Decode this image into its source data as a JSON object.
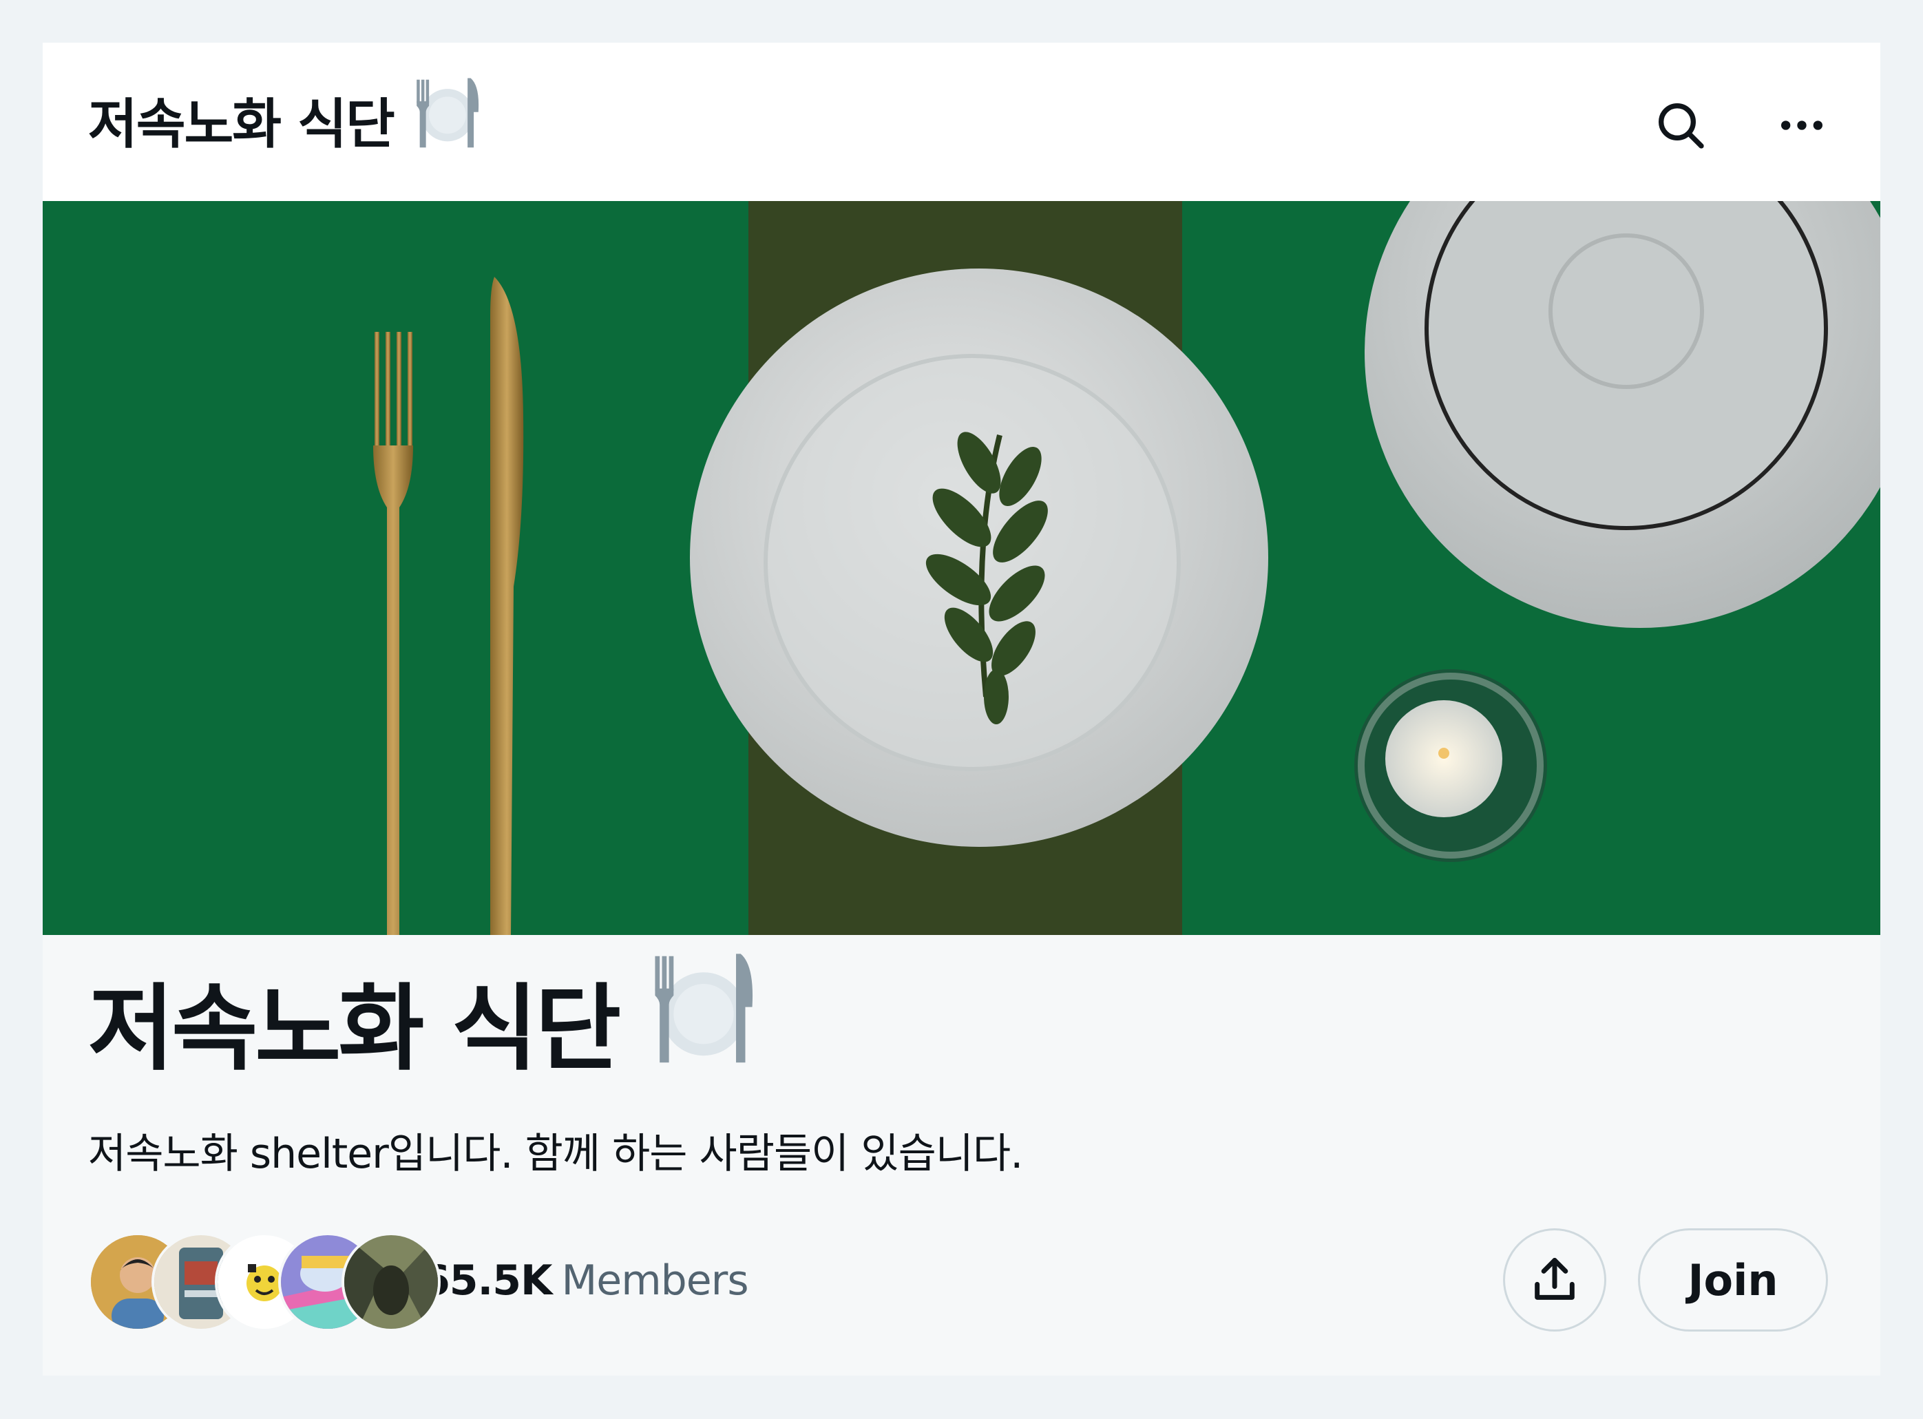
{
  "header": {
    "title": "저속노화 식단",
    "title_icon": "fork-knife-plate-icon",
    "actions": [
      {
        "name": "search",
        "icon": "search-icon"
      },
      {
        "name": "more",
        "icon": "more-icon"
      }
    ]
  },
  "banner": {
    "image_subject": "place setting with a speckled plate holding a sprig of greenery, gold fork and knife, a saucer and a tealight candle on a green tablecloth"
  },
  "community": {
    "title": "저속노화 식단",
    "title_icon": "fork-knife-plate-icon",
    "description": "저속노화 shelter입니다. 함께 하는 사람들이 있습니다.",
    "members_count": "65.5K",
    "members_label": "Members",
    "avatar_count": 5
  },
  "actions": {
    "share_icon": "share-icon",
    "join_label": "Join"
  },
  "colors": {
    "page_background": "#eff3f6",
    "card_background": "#f6f8f9",
    "text_primary": "#0f1419",
    "text_secondary": "#536471",
    "button_border": "#cfd9de",
    "tablecloth_green": "#0b6b3a"
  }
}
